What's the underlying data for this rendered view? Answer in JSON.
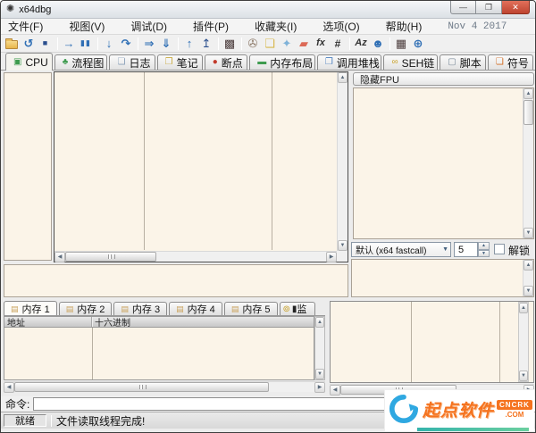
{
  "window": {
    "title": "x64dbg",
    "minimize_glyph": "—",
    "maximize_glyph": "❐",
    "close_glyph": "✕",
    "bug_icon_glyph": "✺"
  },
  "menu": {
    "items": [
      {
        "label": "文件(F)"
      },
      {
        "label": "视图(V)"
      },
      {
        "label": "调试(D)"
      },
      {
        "label": "插件(P)"
      },
      {
        "label": "收藏夹(I)"
      },
      {
        "label": "选项(O)"
      },
      {
        "label": "帮助(H)"
      }
    ],
    "build_date": "Nov 4 2017"
  },
  "toolbar": {
    "icons": [
      {
        "name": "open-file-icon",
        "glyph": ""
      },
      {
        "name": "restart-icon",
        "glyph": "↺"
      },
      {
        "name": "stop-icon",
        "glyph": "■"
      },
      {
        "name": "run-icon",
        "glyph": "→"
      },
      {
        "name": "pause-icon",
        "glyph": "▮▮"
      },
      {
        "name": "step-into-icon",
        "glyph": "↓"
      },
      {
        "name": "step-over-icon",
        "glyph": "↷"
      },
      {
        "name": "execute-till-return-icon",
        "glyph": "⇒"
      },
      {
        "name": "run-to-user-code-icon",
        "glyph": "⇓"
      },
      {
        "name": "step-out-icon",
        "glyph": "↑"
      },
      {
        "name": "attach-icon",
        "glyph": "↥"
      },
      {
        "name": "settings-icon",
        "glyph": "▩"
      },
      {
        "name": "patches-icon",
        "glyph": "✇"
      },
      {
        "name": "notes-icon",
        "glyph": "❏"
      },
      {
        "name": "highlight-icon",
        "glyph": "✦"
      },
      {
        "name": "eraser-icon",
        "glyph": "▰"
      },
      {
        "name": "functions-icon",
        "glyph": "fx"
      },
      {
        "name": "analysis-icon",
        "glyph": "#"
      },
      {
        "name": "ascii-table-icon",
        "glyph": "Az"
      },
      {
        "name": "scylla-icon",
        "glyph": "☻"
      },
      {
        "name": "calculator-icon",
        "glyph": "▦"
      },
      {
        "name": "website-icon",
        "glyph": "⊕"
      }
    ]
  },
  "tabs": [
    {
      "label": "CPU",
      "icon": "▣",
      "active": "true"
    },
    {
      "label": "流程图",
      "icon": "♣"
    },
    {
      "label": "日志",
      "icon": "❏"
    },
    {
      "label": "笔记",
      "icon": "❐"
    },
    {
      "label": "断点",
      "icon": "●"
    },
    {
      "label": "内存布局",
      "icon": "▬"
    },
    {
      "label": "调用堆栈",
      "icon": "❐"
    },
    {
      "label": "SEH链",
      "icon": "∞"
    },
    {
      "label": "脚本",
      "icon": "▢"
    },
    {
      "label": "符号",
      "icon": "❏"
    }
  ],
  "registers": {
    "hide_fpu_label": "隐藏FPU",
    "calling_convention": "默认 (x64 fastcall)",
    "arg_count": "5",
    "unlock_label": "解锁"
  },
  "dump": {
    "tabs": [
      {
        "label": "内存 1",
        "active": "true"
      },
      {
        "label": "内存 2"
      },
      {
        "label": "内存 3"
      },
      {
        "label": "内存 4"
      },
      {
        "label": "内存 5"
      }
    ],
    "watch_tab_partial": "监",
    "columns": [
      "地址",
      "十六进制"
    ]
  },
  "command": {
    "label": "命令:",
    "value": ""
  },
  "status": {
    "state": "就绪",
    "message": "文件读取线程完成!"
  },
  "watermark": {
    "brand": "起点软件",
    "badge": "CNCRK",
    "domain": ".COM"
  },
  "colors": {
    "panel_cream": "#FBF4E8",
    "toolbar_blue": "#2F6FB5",
    "close_red": "#BE4430",
    "watermark_orange": "#F5731F",
    "watermark_blue": "#2FA8E1",
    "tab_green": "#3E9B4F",
    "breakpoint_red": "#C23B2B"
  }
}
